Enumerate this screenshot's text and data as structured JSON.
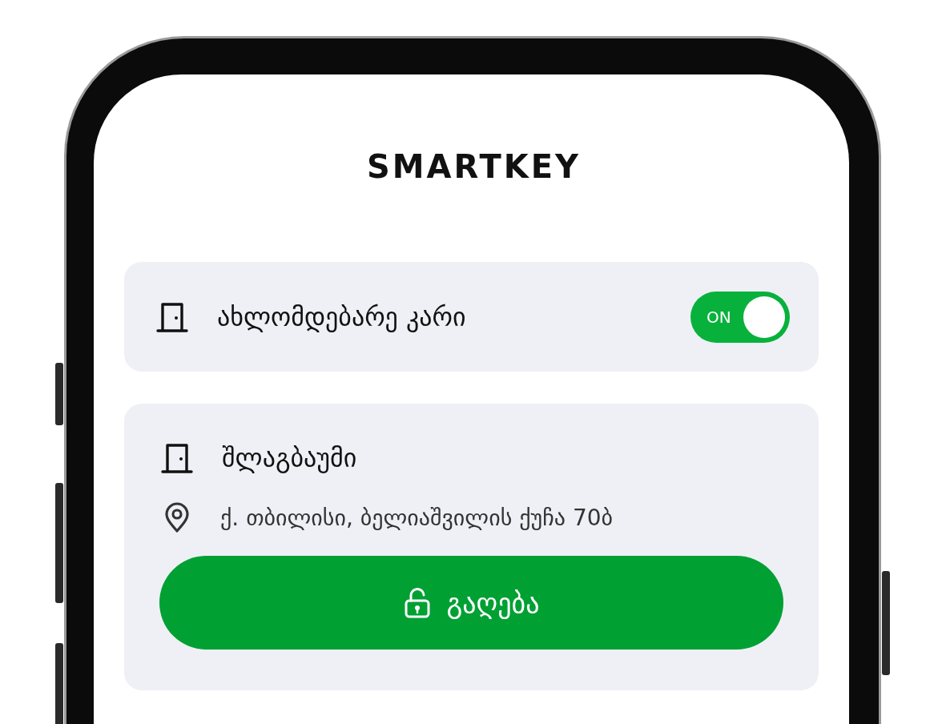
{
  "app": {
    "logo": "SMARTKEY"
  },
  "nearby_door": {
    "label": "ახლომდებარე კარი",
    "toggle_label": "ON",
    "on": true
  },
  "door": {
    "name": "შლაგბაუმი",
    "address": "ქ. თბილისი, ბელიაშვილის ქუჩა 70ბ",
    "open_button": "გაღება"
  }
}
